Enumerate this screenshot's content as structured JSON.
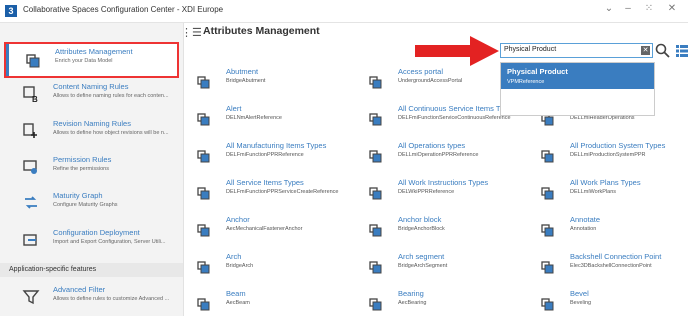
{
  "window": {
    "title": "Collaborative Spaces Configuration Center - XDI Europe",
    "logo_letter": "3",
    "minimize": "–",
    "restore": "⁙",
    "close": "✕",
    "collapse": "⌄"
  },
  "sidebar": {
    "items": [
      {
        "title": "Attributes Management",
        "desc": "Enrich your Data Model"
      },
      {
        "title": "Content Naming Rules",
        "desc": "Allows to define naming rules for each conten..."
      },
      {
        "title": "Revision Naming Rules",
        "desc": "Allows to define how object revisions will be n..."
      },
      {
        "title": "Permission Rules",
        "desc": "Refine the permissions"
      },
      {
        "title": "Maturity Graph",
        "desc": "Configure Maturity Graphs"
      },
      {
        "title": "Configuration Deployment",
        "desc": "Import and Export Configuration, Server Utili..."
      }
    ],
    "section_heading": "Application-specific features",
    "extra_item": {
      "title": "Advanced Filter",
      "desc": "Allows to define rules to customize Advanced ..."
    }
  },
  "main": {
    "title": "Attributes Management",
    "search_value": "Physical Product",
    "dropdown": {
      "title": "Physical Product",
      "sub": "VPMReference"
    },
    "cards": [
      {
        "title": "Abutment",
        "sub": "BridgeAbutment"
      },
      {
        "title": "Access portal",
        "sub": "UndergroundAccessPortal"
      },
      {
        "title": "",
        "sub": ""
      },
      {
        "title": "Alert",
        "sub": "DELNmAlertReference"
      },
      {
        "title": "All Continuous Service Items Types",
        "sub": "DELFmiFunctionServiceContinuousReference"
      },
      {
        "title": "",
        "sub": "DELLmiHeaderOperations"
      },
      {
        "title": "All Manufacturing Items Types",
        "sub": "DELFmiFunctionPPRReference"
      },
      {
        "title": "All Operations types",
        "sub": "DELLmiOperationPPRReference"
      },
      {
        "title": "All Production System Types",
        "sub": "DELLmiProductionSystemPPR"
      },
      {
        "title": "All Service Items Types",
        "sub": "DELFmiFunctionPPRServiceCreateReference"
      },
      {
        "title": "All Work Instructions Types",
        "sub": "DELWkiPPRReference"
      },
      {
        "title": "All Work Plans Types",
        "sub": "DELLmiWorkPlans"
      },
      {
        "title": "Anchor",
        "sub": "AecMechanicalFastenerAnchor"
      },
      {
        "title": "Anchor block",
        "sub": "BridgeAnchorBlock"
      },
      {
        "title": "Annotate",
        "sub": "Annotation"
      },
      {
        "title": "Arch",
        "sub": "BridgeArch"
      },
      {
        "title": "Arch segment",
        "sub": "BridgeArchSegment"
      },
      {
        "title": "Backshell Connection Point",
        "sub": "Elec3DBackshellConnectionPoint"
      },
      {
        "title": "Beam",
        "sub": "AecBeam"
      },
      {
        "title": "Bearing",
        "sub": "AecBearing"
      },
      {
        "title": "Bevel",
        "sub": "Beveling"
      }
    ]
  },
  "colors": {
    "accent": "#3a7dc0",
    "highlight_border": "#e33333",
    "arrow": "#e32222"
  }
}
